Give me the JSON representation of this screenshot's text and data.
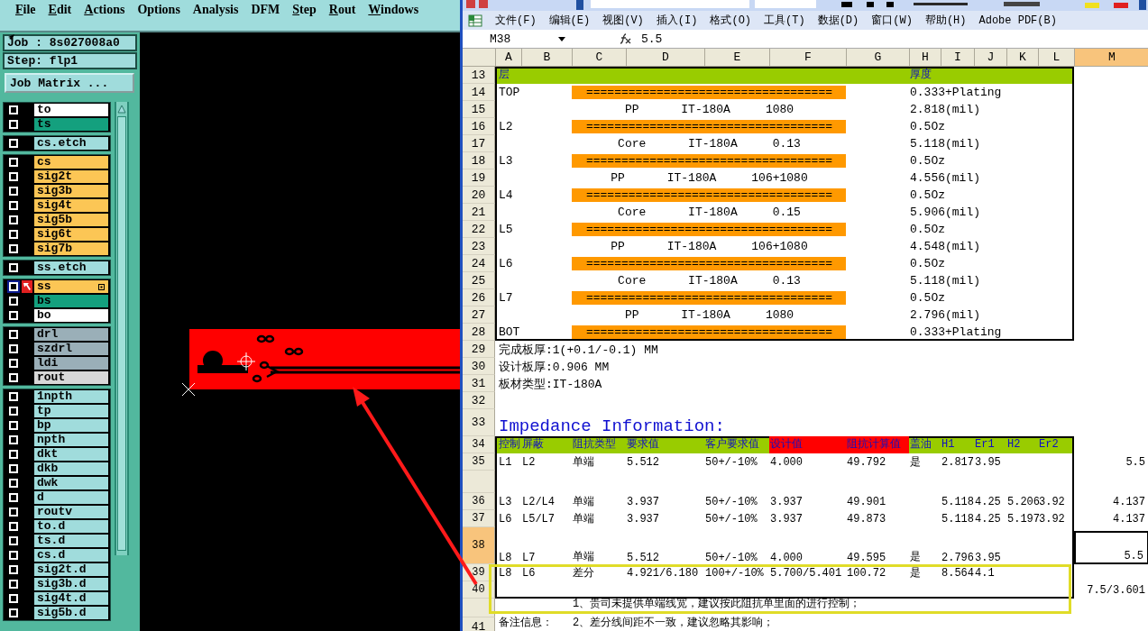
{
  "cam": {
    "menu": [
      {
        "label": "File",
        "underlined": true
      },
      {
        "label": "Edit",
        "underlined": true
      },
      {
        "label": "Actions",
        "underlined": true
      },
      {
        "label": "Options",
        "underlined": false
      },
      {
        "label": "Analysis",
        "underlined": false
      },
      {
        "label": "DFM",
        "underlined": false
      },
      {
        "label": "Step",
        "underlined": true
      },
      {
        "label": "Rout",
        "underlined": true
      },
      {
        "label": "Windows",
        "underlined": true
      }
    ],
    "job": "Job : 8s027008a0",
    "step": "Step: flp1",
    "matrix_button": "Job Matrix ...",
    "layer_groups": [
      {
        "layers": [
          {
            "name": "to",
            "color": "#ffffff",
            "selected": false
          },
          {
            "name": "ts",
            "color": "#14a07e",
            "selected": false
          }
        ]
      },
      {
        "layers": [
          {
            "name": "cs.etch",
            "color": "#a0dcdc",
            "selected": false
          }
        ]
      },
      {
        "layers": [
          {
            "name": "cs",
            "color": "#fcc655",
            "selected": false
          },
          {
            "name": "sig2t",
            "color": "#fcc655",
            "selected": false
          },
          {
            "name": "sig3b",
            "color": "#fcc655",
            "selected": false
          },
          {
            "name": "sig4t",
            "color": "#fcc655",
            "selected": false
          },
          {
            "name": "sig5b",
            "color": "#fcc655",
            "selected": false
          },
          {
            "name": "sig6t",
            "color": "#fcc655",
            "selected": false
          },
          {
            "name": "sig7b",
            "color": "#fcc655",
            "selected": false
          }
        ]
      },
      {
        "layers": [
          {
            "name": "ss.etch",
            "color": "#a0dcdc",
            "selected": false
          }
        ]
      },
      {
        "layers": [
          {
            "name": "ss",
            "color": "#fcc655",
            "selected": true
          },
          {
            "name": "bs",
            "color": "#14a07e",
            "selected": false
          },
          {
            "name": "bo",
            "color": "#ffffff",
            "selected": false
          }
        ]
      },
      {
        "layers": [
          {
            "name": "drl",
            "color": "#9aafb8",
            "selected": false
          },
          {
            "name": "szdrl",
            "color": "#9aafb8",
            "selected": false
          },
          {
            "name": "ldi",
            "color": "#9aafb8",
            "selected": false
          },
          {
            "name": "rout",
            "color": "#d8d8d8",
            "selected": false
          }
        ]
      },
      {
        "layers": [
          {
            "name": "1npth",
            "color": "#a0dcdc",
            "selected": false
          },
          {
            "name": "tp",
            "color": "#a0dcdc",
            "selected": false
          },
          {
            "name": "bp",
            "color": "#a0dcdc",
            "selected": false
          },
          {
            "name": "npth",
            "color": "#a0dcdc",
            "selected": false
          },
          {
            "name": "dkt",
            "color": "#a0dcdc",
            "selected": false
          },
          {
            "name": "dkb",
            "color": "#a0dcdc",
            "selected": false
          },
          {
            "name": "dwk",
            "color": "#a0dcdc",
            "selected": false
          },
          {
            "name": "d",
            "color": "#a0dcdc",
            "selected": false
          },
          {
            "name": "routv",
            "color": "#a0dcdc",
            "selected": false
          },
          {
            "name": "to.d",
            "color": "#a0dcdc",
            "selected": false
          },
          {
            "name": "ts.d",
            "color": "#a0dcdc",
            "selected": false
          },
          {
            "name": "cs.d",
            "color": "#a0dcdc",
            "selected": false
          },
          {
            "name": "sig2t.d",
            "color": "#a0dcdc",
            "selected": false
          },
          {
            "name": "sig3b.d",
            "color": "#a0dcdc",
            "selected": false
          },
          {
            "name": "sig4t.d",
            "color": "#a0dcdc",
            "selected": false
          },
          {
            "name": "sig5b.d",
            "color": "#a0dcdc",
            "selected": false
          }
        ]
      }
    ]
  },
  "excel": {
    "menu": [
      "文件(F)",
      "编辑(E)",
      "视图(V)",
      "插入(I)",
      "格式(O)",
      "工具(T)",
      "数据(D)",
      "窗口(W)",
      "帮助(H)",
      "Adobe PDF(B)"
    ],
    "name_box": "M38",
    "formula": "5.5",
    "columns": [
      {
        "label": "A",
        "selected": false
      },
      {
        "label": "B",
        "selected": false
      },
      {
        "label": "C",
        "selected": false
      },
      {
        "label": "D",
        "selected": false
      },
      {
        "label": "E",
        "selected": false
      },
      {
        "label": "F",
        "selected": false
      },
      {
        "label": "G",
        "selected": false
      },
      {
        "label": "H",
        "selected": false
      },
      {
        "label": "I",
        "selected": false
      },
      {
        "label": "J",
        "selected": false
      },
      {
        "label": "K",
        "selected": false
      },
      {
        "label": "L",
        "selected": false
      },
      {
        "label": "M",
        "selected": true
      }
    ],
    "blocks": [
      {
        "kind": "table",
        "rows": [
          {
            "num": "13",
            "kind": "stack-header",
            "selected": false,
            "cells": [
              "层",
              "",
              "",
              "",
              "",
              "",
              "",
              "厚度"
            ]
          },
          {
            "num": "14",
            "kind": "copper",
            "selected": false,
            "cells": [
              "TOP",
              "",
              "===================================",
              "",
              "",
              "",
              "",
              "0.333+Plating"
            ]
          },
          {
            "num": "15",
            "kind": "dielectric",
            "selected": false,
            "cells": [
              "",
              "",
              "PP      IT-180A     1080",
              "",
              "",
              "",
              "",
              "2.818(mil)"
            ]
          },
          {
            "num": "16",
            "kind": "copper",
            "selected": false,
            "cells": [
              "L2",
              "",
              "===================================",
              "",
              "",
              "",
              "",
              "0.5Oz"
            ]
          },
          {
            "num": "17",
            "kind": "dielectric",
            "selected": false,
            "cells": [
              "",
              "",
              "Core      IT-180A     0.13",
              "",
              "",
              "",
              "",
              "5.118(mil)"
            ]
          },
          {
            "num": "18",
            "kind": "copper",
            "selected": false,
            "cells": [
              "L3",
              "",
              "===================================",
              "",
              "",
              "",
              "",
              "0.5Oz"
            ]
          },
          {
            "num": "19",
            "kind": "dielectric",
            "selected": false,
            "cells": [
              "",
              "",
              "PP      IT-180A     106+1080",
              "",
              "",
              "",
              "",
              "4.556(mil)"
            ]
          },
          {
            "num": "20",
            "kind": "copper",
            "selected": false,
            "cells": [
              "L4",
              "",
              "===================================",
              "",
              "",
              "",
              "",
              "0.5Oz"
            ]
          },
          {
            "num": "21",
            "kind": "dielectric",
            "selected": false,
            "cells": [
              "",
              "",
              "Core      IT-180A     0.15",
              "",
              "",
              "",
              "",
              "5.906(mil)"
            ]
          },
          {
            "num": "22",
            "kind": "copper",
            "selected": false,
            "cells": [
              "L5",
              "",
              "===================================",
              "",
              "",
              "",
              "",
              "0.5Oz"
            ]
          },
          {
            "num": "23",
            "kind": "dielectric",
            "selected": false,
            "cells": [
              "",
              "",
              "PP      IT-180A     106+1080",
              "",
              "",
              "",
              "",
              "4.548(mil)"
            ]
          },
          {
            "num": "24",
            "kind": "copper",
            "selected": false,
            "cells": [
              "L6",
              "",
              "===================================",
              "",
              "",
              "",
              "",
              "0.5Oz"
            ]
          },
          {
            "num": "25",
            "kind": "dielectric",
            "selected": false,
            "cells": [
              "",
              "",
              "Core      IT-180A     0.13",
              "",
              "",
              "",
              "",
              "5.118(mil)"
            ]
          },
          {
            "num": "26",
            "kind": "copper",
            "selected": false,
            "cells": [
              "L7",
              "",
              "===================================",
              "",
              "",
              "",
              "",
              "0.5Oz"
            ]
          },
          {
            "num": "27",
            "kind": "dielectric",
            "selected": false,
            "cells": [
              "",
              "",
              "PP      IT-180A     1080",
              "",
              "",
              "",
              "",
              "2.796(mil)"
            ]
          },
          {
            "num": "28",
            "kind": "copper",
            "selected": false,
            "cells": [
              "BOT",
              "",
              "===================================",
              "",
              "",
              "",
              "",
              "0.333+Plating"
            ]
          }
        ]
      },
      {
        "kind": "plain",
        "rows": [
          {
            "num": "29",
            "kind": "text",
            "selected": false,
            "cells": [
              "完成板厚:1(+0.1/-0.1) MM"
            ]
          },
          {
            "num": "30",
            "kind": "text",
            "selected": false,
            "cells": [
              "设计板厚:0.906 MM"
            ]
          },
          {
            "num": "31",
            "kind": "text",
            "selected": false,
            "cells": [
              "板材类型:IT-180A"
            ]
          },
          {
            "num": "32",
            "kind": "text",
            "selected": false
          },
          {
            "num": "33",
            "kind": "title",
            "selected": false,
            "cells": [
              "Impedance Information:"
            ]
          }
        ]
      },
      {
        "kind": "table",
        "rows": [
          {
            "num": "34",
            "kind": "imp-header",
            "selected": false,
            "cells": [
              "控制",
              "屏蔽",
              "阻抗类型",
              "要求值",
              "客户要求值",
              {
                "text": "设计值",
                "color": "#ff0000"
              },
              {
                "text": "阻抗计算值",
                "color": "#ff0000"
              },
              "盖油",
              "H1",
              "Er1",
              "H2",
              "Er2"
            ]
          },
          {
            "num": "35",
            "kind": "imp",
            "selected": false,
            "cells": [
              "L1",
              "L2",
              "单端",
              "5.512",
              "50+/-10%",
              "4.000",
              "49.792",
              "是",
              "2.817",
              "3.95",
              "",
              "",
              "5.5"
            ]
          },
          {
            "kind": "spacer",
            "selected": false
          },
          {
            "num": "36",
            "kind": "imp",
            "selected": false,
            "cells": [
              "L3",
              "L2/L4",
              "单端",
              "3.937",
              "50+/-10%",
              "3.937",
              "49.901",
              "",
              "5.118",
              "4.25",
              "5.206",
              "3.92",
              "4.137"
            ]
          },
          {
            "num": "37",
            "kind": "imp",
            "selected": false,
            "cells": [
              "L6",
              "L5/L7",
              "单端",
              "3.937",
              "50+/-10%",
              "3.937",
              "49.873",
              "",
              "5.118",
              "4.25",
              "5.197",
              "3.92",
              "4.137"
            ]
          },
          {
            "num": "38",
            "kind": "imp-tall",
            "selected": true,
            "cells": [
              "L8",
              "L7",
              "单端",
              "5.512",
              "50+/-10%",
              "4.000",
              "49.595",
              "是",
              "2.796",
              "3.95",
              "",
              "",
              {
                "text": "5.5",
                "selected": true
              }
            ]
          },
          {
            "num": "39",
            "kind": "imp",
            "selected": false,
            "cells": [
              "L8",
              "L6",
              "差分",
              "4.921/6.180",
              "100+/-10%",
              "5.700/5.401",
              "100.72",
              "是",
              "8.564",
              "4.1"
            ]
          },
          {
            "num": "40",
            "kind": "imp",
            "selected": false,
            "cells": [
              "",
              "",
              "",
              "",
              "",
              "",
              "",
              "",
              "",
              "",
              "",
              "",
              "7.5/3.601"
            ]
          }
        ]
      },
      {
        "kind": "plain",
        "rows": [
          {
            "kind": "note",
            "selected": false,
            "cells": [
              "",
              "",
              "1、贵司未提供单端线宽，建议按此阻抗单里面的进行控制；"
            ]
          },
          {
            "num": "41",
            "kind": "note",
            "selected": false,
            "cells": [
              "备注信息：",
              "",
              "2、差分线间距不一致，建议忽略其影响；"
            ]
          }
        ]
      }
    ]
  }
}
